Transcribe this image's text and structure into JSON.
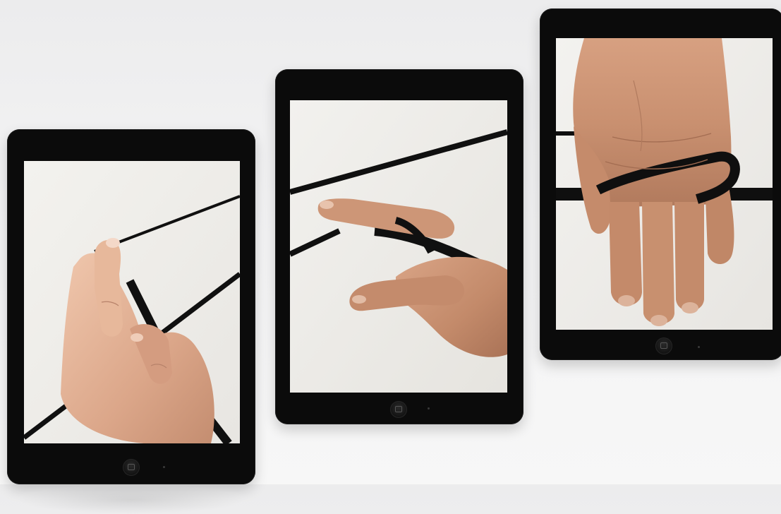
{
  "scene": {
    "tablets": [
      {
        "screen": "hand-holding-strap-loop",
        "colors": {
          "strap": "#101010",
          "skin": "#d9a88a"
        }
      },
      {
        "screen": "hand-threading-strap-between-fingers",
        "colors": {
          "strap": "#101010",
          "skin": "#c88d6c"
        }
      },
      {
        "screen": "palm-with-strap-looped-over-fingers",
        "colors": {
          "strap": "#101010",
          "skin": "#c8906f"
        }
      }
    ]
  }
}
